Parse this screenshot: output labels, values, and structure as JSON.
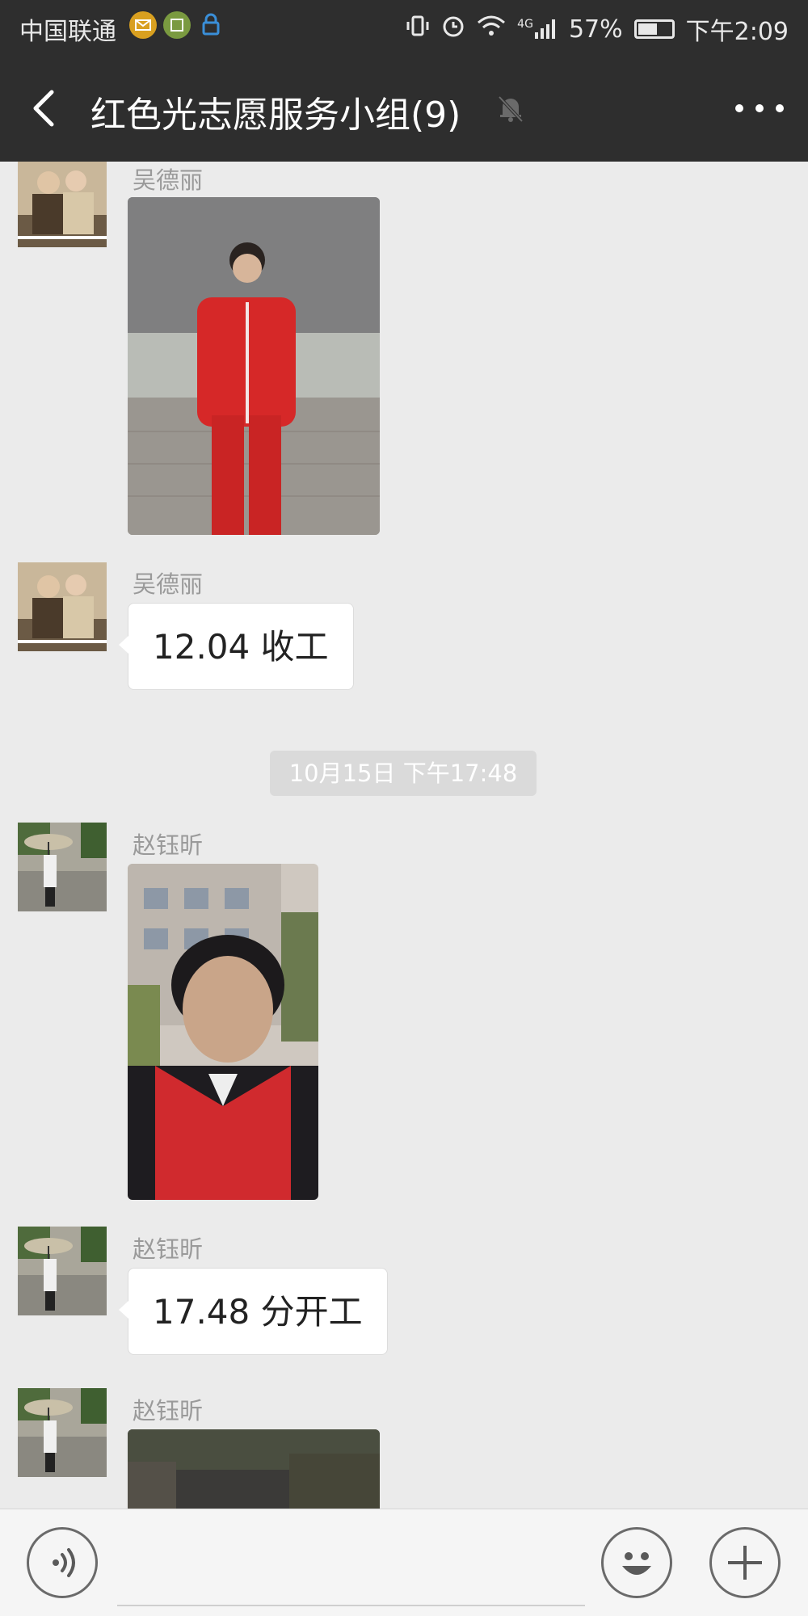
{
  "status_bar": {
    "carrier": "中国联通",
    "battery": "57%",
    "battery_level": 0.57,
    "time": "下午2:09",
    "network": "4G"
  },
  "header": {
    "title": "红色光志愿服务小组(9)",
    "muted": true
  },
  "messages": [
    {
      "sender": "吴德丽",
      "type": "image",
      "icon": "photo"
    },
    {
      "sender": "吴德丽",
      "type": "text",
      "text": "12.04 收工"
    },
    {
      "type": "timestamp",
      "text": "10月15日 下午17:48"
    },
    {
      "sender": "赵钰昕",
      "type": "image",
      "icon": "photo"
    },
    {
      "sender": "赵钰昕",
      "type": "text",
      "text": "17.48 分开工"
    },
    {
      "sender": "赵钰昕",
      "type": "image",
      "icon": "photo"
    }
  ],
  "input_bar": {
    "value": "",
    "voice_icon": "voice-icon",
    "emoji_icon": "emoji-icon",
    "plus_icon": "plus-icon"
  },
  "colors": {
    "header_bg": "#2e2e2e",
    "chat_bg": "#ebebeb",
    "bubble_bg": "#ffffff",
    "timestamp_bg": "#dadada"
  }
}
